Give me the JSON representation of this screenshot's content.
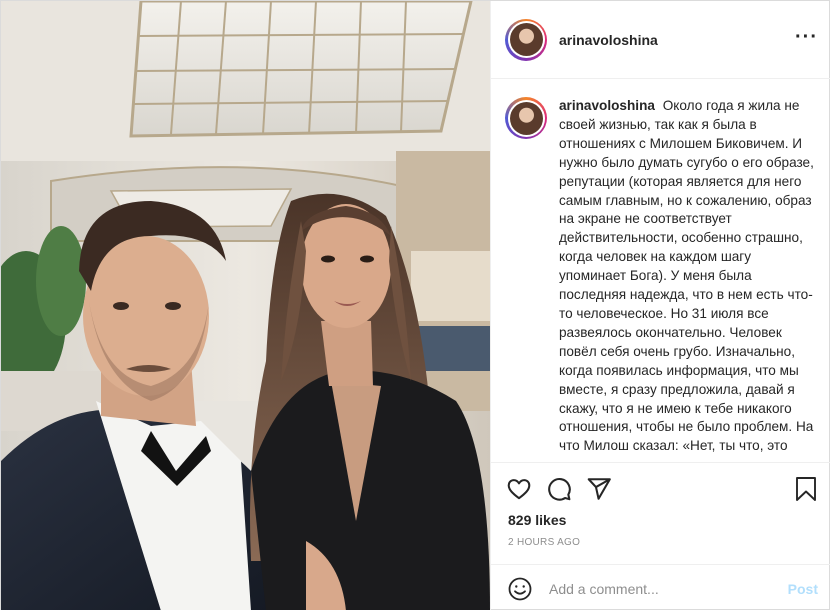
{
  "post": {
    "username": "arinavoloshina",
    "more_icon": "more-horizontal-icon",
    "caption": {
      "username": "arinavoloshina",
      "text": "Около года я жила не своей жизнью, так как я была в отношениях с Милошем Биковичем. И нужно было думать сугубо о его образе, репутации (которая является для него самым главным, но к сожалению, образ на экране не соответствует действительности, особенно страшно, когда человек на каждом шагу упоминает Бога). У меня была последняя надежда, что в нем есть что-то человеческое. Но 31 июля все развеялось окончательно. Человек повёл себя очень грубо. Изначально, когда появилась информация, что мы вместе, я сразу предложила, давай я скажу, что я не имею к тебе никакого отношения, чтобы не было проблем. На что Милош сказал: «Нет, ты что, это"
    },
    "actions": {
      "like_icon": "heart-icon",
      "comment_icon": "comment-icon",
      "share_icon": "share-icon",
      "save_icon": "bookmark-icon"
    },
    "likes": "829 likes",
    "timestamp": "2 HOURS AGO",
    "comment": {
      "emoji_icon": "emoji-icon",
      "placeholder": "Add a comment...",
      "value": "",
      "post_label": "Post"
    }
  },
  "colors": {
    "text": "#262626",
    "muted": "#8e8e8e",
    "border": "#efefef",
    "post_button_disabled": "#b2dffc"
  }
}
